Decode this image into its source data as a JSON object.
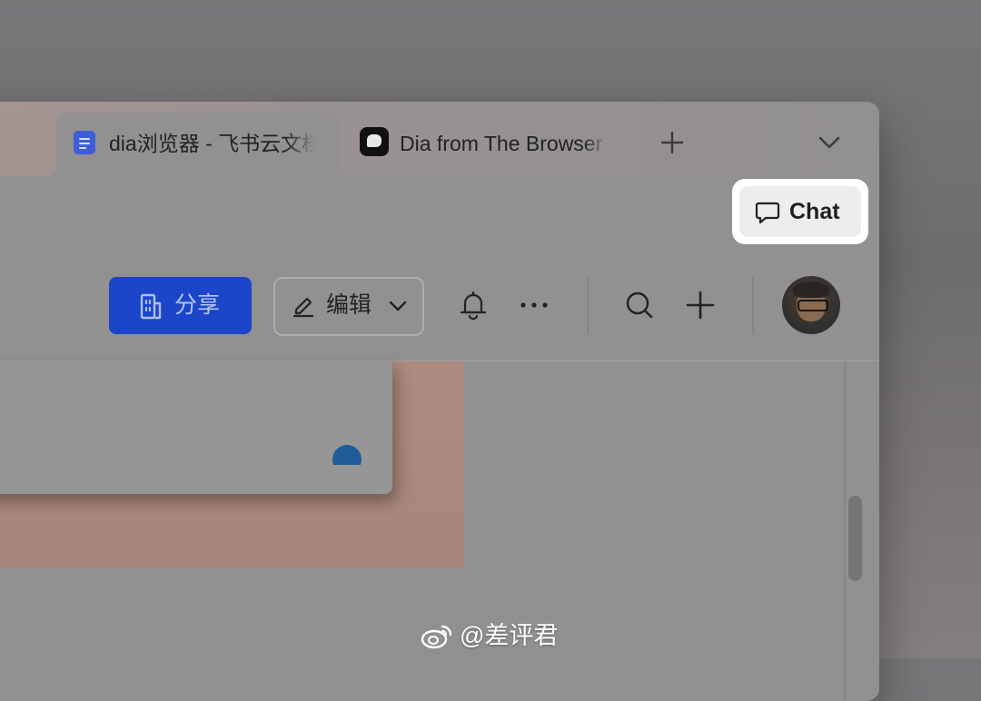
{
  "tabs": [
    {
      "title": "dia浏览器 - 飞书云文档",
      "icon": "doc-icon",
      "active": true
    },
    {
      "title": "Dia from The Browser Company",
      "icon": "dia-logo-icon",
      "active": false
    }
  ],
  "tabstrip": {
    "new_tab_icon": "plus-icon",
    "tab_menu_icon": "chevron-down-icon"
  },
  "chat": {
    "label": "Chat",
    "icon": "chat-bubble-icon"
  },
  "doc_toolbar": {
    "share_label": "分享",
    "share_icon": "building-icon",
    "edit_label": "编辑",
    "edit_icon": "pen-icon",
    "icons": [
      "bell-icon",
      "more-icon",
      "search-icon",
      "plus-icon",
      "avatar"
    ]
  },
  "colors": {
    "share_button": "#1c46c9",
    "chat_highlight": "#ffffff",
    "popup_avatar": "#1f5c99"
  },
  "watermark": {
    "text": "@差评君",
    "icon": "weibo-icon"
  }
}
